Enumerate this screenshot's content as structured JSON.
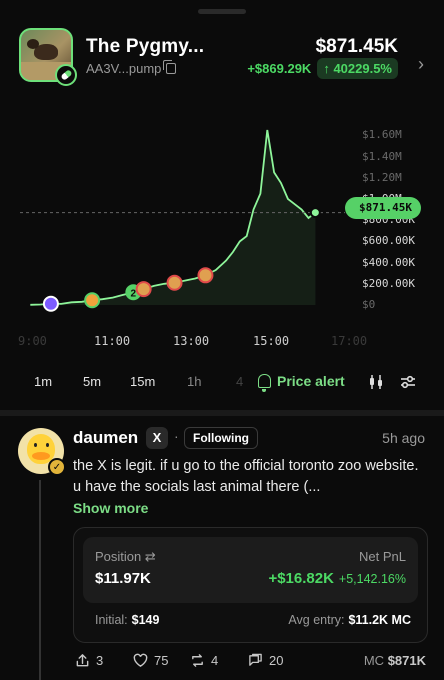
{
  "token": {
    "name": "The Pygmy...",
    "address": "AA3V...pump",
    "price": "$871.45K",
    "change_abs": "+$869.29K",
    "change_pct": "↑ 40229.5%"
  },
  "chart_data": {
    "type": "line",
    "x_ticks": [
      "9:00",
      "11:00",
      "13:00",
      "15:00",
      "17:00"
    ],
    "y_ticks": [
      "$1.60M",
      "$1.40M",
      "$1.20M",
      "$1.00M",
      "$800.00K",
      "$600.00K",
      "$400.00K",
      "$200.00K",
      "$0"
    ],
    "current_label": "$871.45K",
    "series": [
      {
        "x": [
          "9:15",
          "9:30",
          "9:45",
          "10:00",
          "10:15",
          "10:30",
          "10:45",
          "11:00",
          "11:15",
          "11:30",
          "11:45",
          "12:00",
          "12:15",
          "12:30",
          "12:45",
          "13:00",
          "13:15",
          "13:30",
          "13:45",
          "14:00",
          "14:10",
          "14:20",
          "14:30",
          "14:40",
          "14:50",
          "15:00",
          "15:10",
          "15:20",
          "15:30",
          "15:40",
          "15:50",
          "16:00",
          "16:10"
        ],
        "y": [
          2000,
          5000,
          12000,
          10000,
          25000,
          30000,
          45000,
          55000,
          70000,
          95000,
          120000,
          150000,
          180000,
          200000,
          210000,
          230000,
          250000,
          280000,
          330000,
          420000,
          500000,
          600000,
          650000,
          900000,
          1050000,
          1650000,
          1250000,
          1150000,
          1000000,
          950000,
          900000,
          820000,
          871450
        ]
      }
    ],
    "markers": [
      "2",
      "3"
    ]
  },
  "timeframes": [
    "1m",
    "5m",
    "15m",
    "1h",
    "4"
  ],
  "price_alert_label": "Price alert",
  "post": {
    "author": "daumen",
    "x_label": "X",
    "separator": "·",
    "follow_label": "Following",
    "time": "5h ago",
    "text": "the X is legit. if u go to the official toronto zoo website. u have the socials last animal there (...",
    "show_more": "Show more"
  },
  "position": {
    "label": "Position ⇄",
    "value": "$11.97K",
    "pnl_label": "Net PnL",
    "pnl_abs": "+$16.82K",
    "pnl_pct": "+5,142.16%",
    "initial_label": "Initial:",
    "initial_value": "$149",
    "avg_label": "Avg entry:",
    "avg_value": "$11.2K MC"
  },
  "actions": {
    "shares": "3",
    "likes": "75",
    "reposts": "4",
    "comments": "20",
    "mc_label": "MC",
    "mc_value": "$871K"
  },
  "colors": {
    "accent": "#4cd964",
    "background": "#0b0b0b"
  }
}
